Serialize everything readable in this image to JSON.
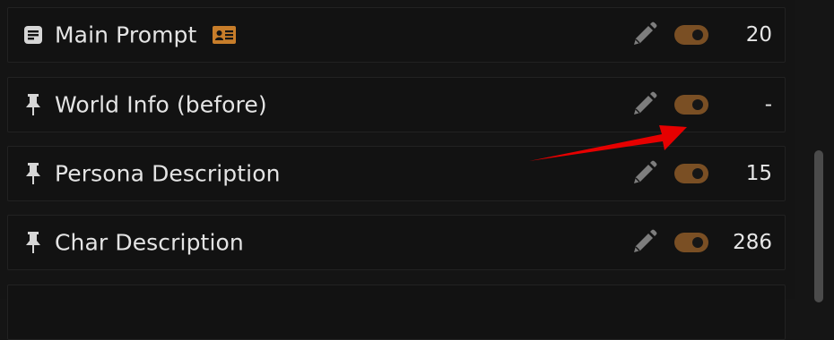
{
  "rows": [
    {
      "label": "Main Prompt",
      "icon": "list-doc-icon",
      "count": "20",
      "has_badge": true
    },
    {
      "label": "World Info (before)",
      "icon": "pin-icon",
      "count": "-"
    },
    {
      "label": "Persona Description",
      "icon": "pin-icon",
      "count": "15"
    },
    {
      "label": "Char Description",
      "icon": "pin-icon",
      "count": "286"
    }
  ],
  "colors": {
    "toggle_on": "#7a4f24",
    "badge": "#c77d2a",
    "annotation_arrow": "#e60000"
  }
}
